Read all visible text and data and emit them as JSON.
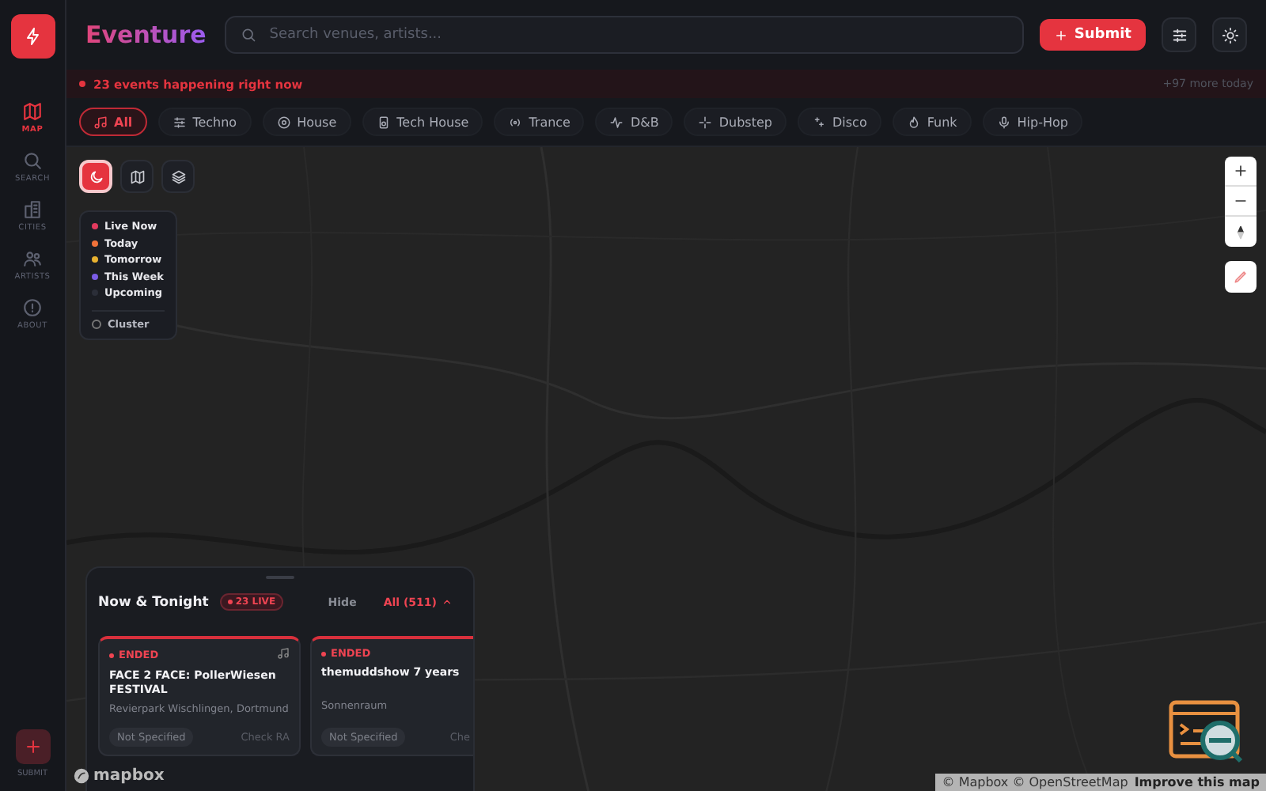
{
  "app": {
    "name": "Eventure"
  },
  "search": {
    "placeholder": "Search venues, artists..."
  },
  "submit_button": {
    "label": "Submit"
  },
  "sidebar": {
    "items": [
      {
        "label": "MAP",
        "selected": true
      },
      {
        "label": "SEARCH",
        "selected": false
      },
      {
        "label": "CITIES",
        "selected": false
      },
      {
        "label": "ARTISTS",
        "selected": false
      },
      {
        "label": "ABOUT",
        "selected": false
      }
    ],
    "submit_label": "SUBMIT"
  },
  "banner": {
    "live_text": "23 events happening right now",
    "more_text": "+97 more today"
  },
  "genres": [
    {
      "label": "All",
      "selected": true
    },
    {
      "label": "Techno",
      "selected": false
    },
    {
      "label": "House",
      "selected": false
    },
    {
      "label": "Tech House",
      "selected": false
    },
    {
      "label": "Trance",
      "selected": false
    },
    {
      "label": "D&B",
      "selected": false
    },
    {
      "label": "Dubstep",
      "selected": false
    },
    {
      "label": "Disco",
      "selected": false
    },
    {
      "label": "Funk",
      "selected": false
    },
    {
      "label": "Hip-Hop",
      "selected": false
    }
  ],
  "map_modes": [
    {
      "selected": true
    },
    {
      "selected": false
    },
    {
      "selected": false
    }
  ],
  "legend": {
    "items": [
      {
        "label": "Live Now",
        "color": "#e23a5e"
      },
      {
        "label": "Today",
        "color": "#f0723a"
      },
      {
        "label": "Tomorrow",
        "color": "#e8b130"
      },
      {
        "label": "This Week",
        "color": "#7b5ce6"
      },
      {
        "label": "Upcoming",
        "color": "#2b2e38"
      }
    ],
    "cluster": {
      "label": "Cluster",
      "checked": false
    }
  },
  "events_panel": {
    "title": "Now & Tonight",
    "live_badge": "23 LIVE",
    "hide": "Hide",
    "all": "All (511)",
    "cards": [
      {
        "status": "ENDED",
        "title": "FACE 2 FACE: PollerWiesen FESTIVAL",
        "venue": "Revierpark Wischlingen, Dortmund",
        "price": "Not Specified",
        "link": "Check RA"
      },
      {
        "status": "ENDED",
        "title": "themuddshow 7 years",
        "venue": "Sonnenraum",
        "price": "Not Specified",
        "link": "Che"
      }
    ]
  },
  "attribution": {
    "logo": "mapbox",
    "copyright": "© Mapbox © OpenStreetMap",
    "improve": "Improve this map"
  }
}
